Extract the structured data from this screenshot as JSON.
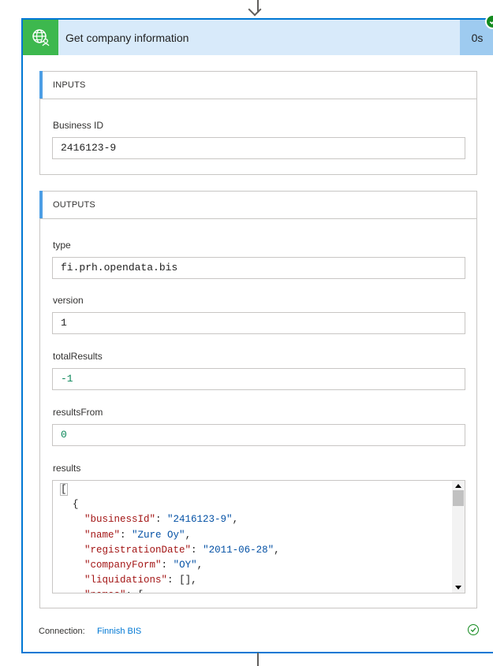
{
  "action": {
    "title": "Get company information",
    "duration": "0s",
    "icon": "globe-person-icon",
    "status_icon": "success-check-icon"
  },
  "inputs": {
    "header": "INPUTS",
    "business_id_label": "Business ID",
    "business_id_value": "2416123-9"
  },
  "outputs": {
    "header": "OUTPUTS",
    "type_label": "type",
    "type_value": "fi.prh.opendata.bis",
    "version_label": "version",
    "version_value": "1",
    "total_results_label": "totalResults",
    "total_results_value": "-1",
    "results_from_label": "resultsFrom",
    "results_from_value": "0",
    "results_label": "results",
    "results_lines": [
      "[",
      "  {",
      "    \"businessId\": \"2416123-9\",",
      "    \"name\": \"Zure Oy\",",
      "    \"registrationDate\": \"2011-06-28\",",
      "    \"companyForm\": \"OY\",",
      "    \"liquidations\": [],",
      "    \"names\": ["
    ]
  },
  "footer": {
    "connection_label": "Connection:",
    "connection_name": "Finnish BIS"
  },
  "colors": {
    "accent": "#0078d4",
    "header_bg": "#d8eafa",
    "icon_bg": "#3db84e",
    "success": "#128a1e",
    "json_key": "#a31515",
    "json_string": "#0451a5",
    "json_number": "#098658"
  }
}
